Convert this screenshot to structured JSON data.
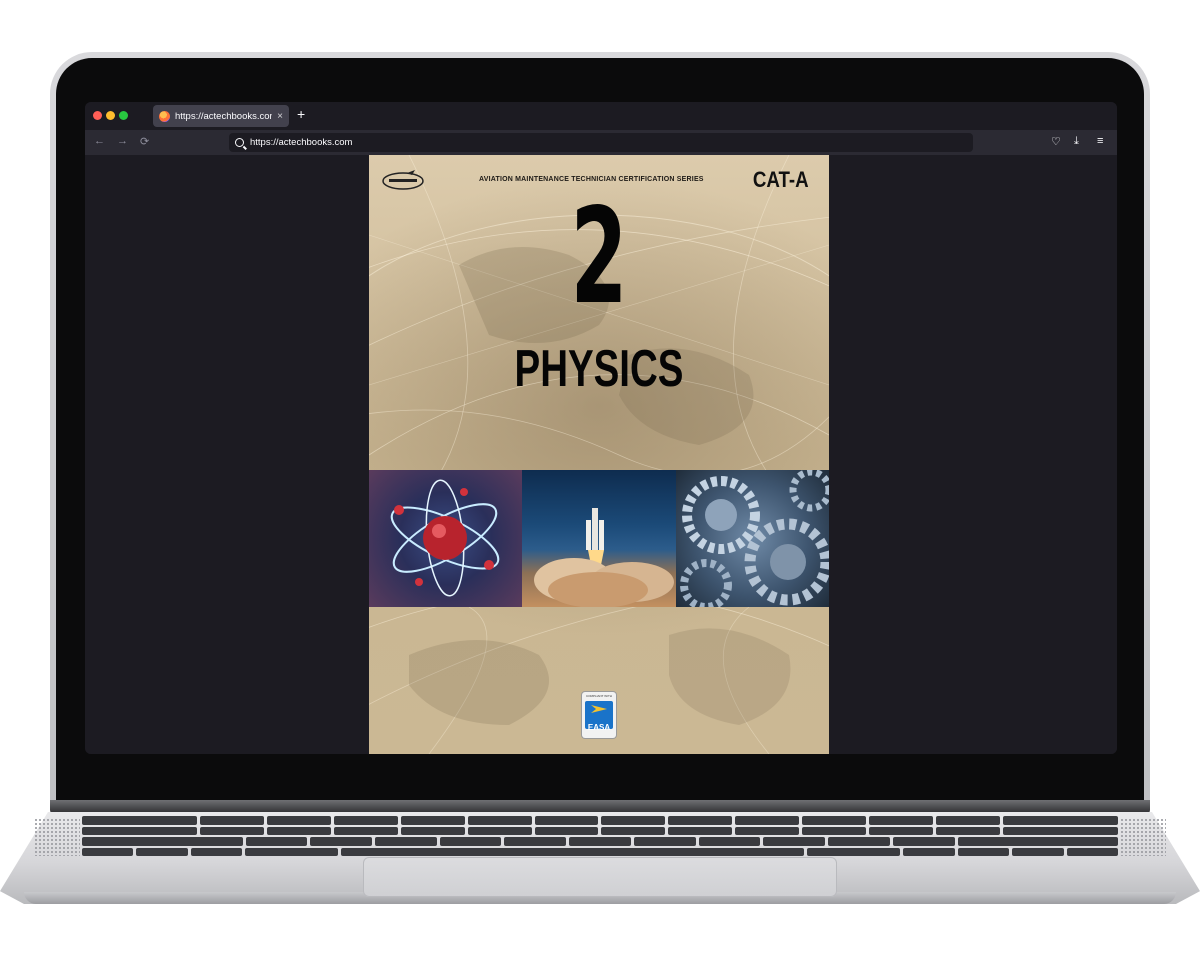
{
  "browser": {
    "tab_title": "https://actechbooks.com",
    "url": "https://actechbooks.com",
    "new_tab": "+",
    "tab_close": "×",
    "back": "←",
    "forward": "→",
    "reload": "⟳",
    "pocket": "♡",
    "download": "⤓",
    "menu": "≡"
  },
  "cover": {
    "series": "AVIATION MAINTENANCE TECHNICIAN CERTIFICATION SERIES",
    "category": "CAT-A",
    "module_number": "2",
    "subject": "PHYSICS",
    "logo_text": "AIRCRAFT TECHNICAL",
    "badge_top": "COMPLIANT WITH",
    "badge_text": "EASA"
  },
  "colors": {
    "browser_dark": "#1c1b22",
    "toolbar": "#2b2a33",
    "cover_tan": "#c9b692",
    "easa_blue": "#1a73c9"
  }
}
